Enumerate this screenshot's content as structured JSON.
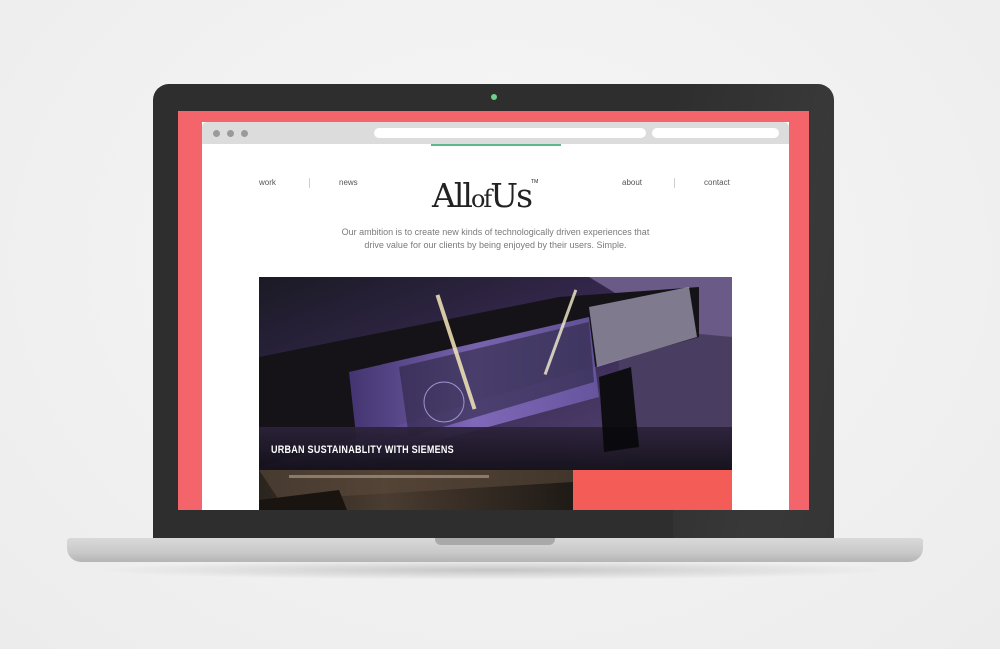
{
  "site": {
    "logo": {
      "main_a": "All",
      "main_b": "of",
      "main_c": "Us",
      "trademark": "TM"
    },
    "nav": {
      "left": [
        "work",
        "news"
      ],
      "right": [
        "about",
        "contact"
      ]
    },
    "tagline_line1": "Our ambition is to create new kinds of technologically driven experiences that",
    "tagline_line2": "drive value for our clients by being enjoyed by their users. Simple.",
    "hero": {
      "caption": "URBAN SUSTAINABLITY WITH SIEMENS"
    }
  },
  "colors": {
    "screen_background": "#f3656a",
    "accent_green": "#5cb88a",
    "tile_red": "#f35c57",
    "camera_light": "#6fd08a"
  },
  "icons": [
    "browser-dot-icon",
    "camera-icon"
  ]
}
